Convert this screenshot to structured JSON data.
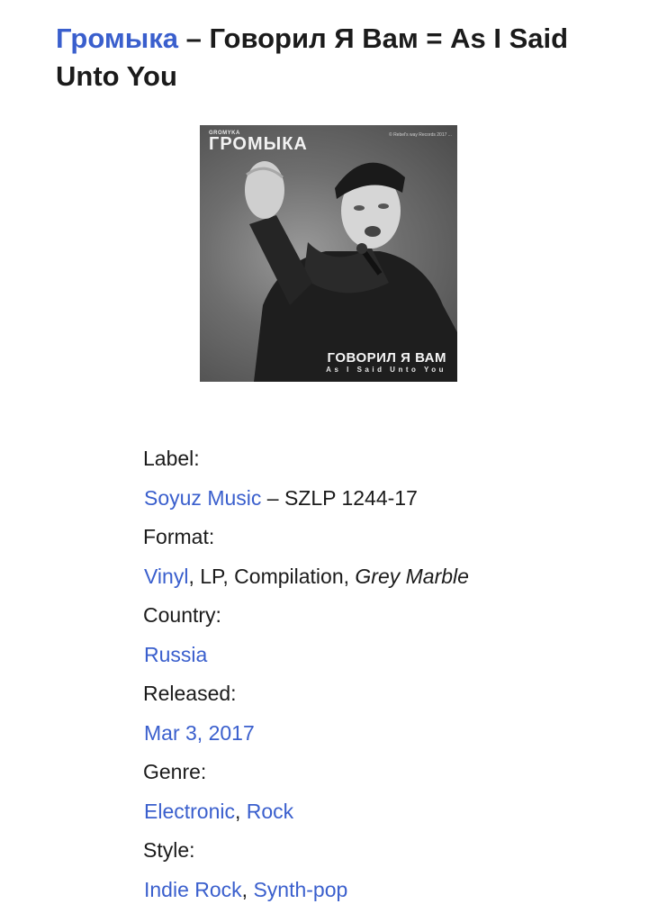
{
  "title": {
    "artist": "Громыка",
    "separator": " – ",
    "album": "Говорил Я Вам = As I Said Unto You"
  },
  "cover": {
    "small_text": "GROMYKA",
    "artist_text": "ГРОМЫКА",
    "publisher_text": "© Rebel's way Records 2017 ...",
    "title_text": "ГОВОРИЛ Я ВАМ",
    "subtitle_text": "As I Said Unto You"
  },
  "details": {
    "label": {
      "heading": "Label:",
      "link": "Soyuz Music",
      "sep": " – ",
      "catalog": "SZLP 1244-17"
    },
    "format": {
      "heading": "Format:",
      "link": "Vinyl",
      "rest": ", LP, Compilation, ",
      "italic": "Grey Marble"
    },
    "country": {
      "heading": "Country:",
      "link": "Russia"
    },
    "released": {
      "heading": "Released:",
      "link": "Mar 3, 2017"
    },
    "genre": {
      "heading": "Genre:",
      "link1": "Electronic",
      "sep": ", ",
      "link2": "Rock"
    },
    "style": {
      "heading": "Style:",
      "link1": "Indie Rock",
      "sep": ", ",
      "link2": "Synth-pop"
    }
  },
  "colors": {
    "link": "#3a5fcd",
    "text": "#1b1b1b",
    "background": "#ffffff"
  }
}
